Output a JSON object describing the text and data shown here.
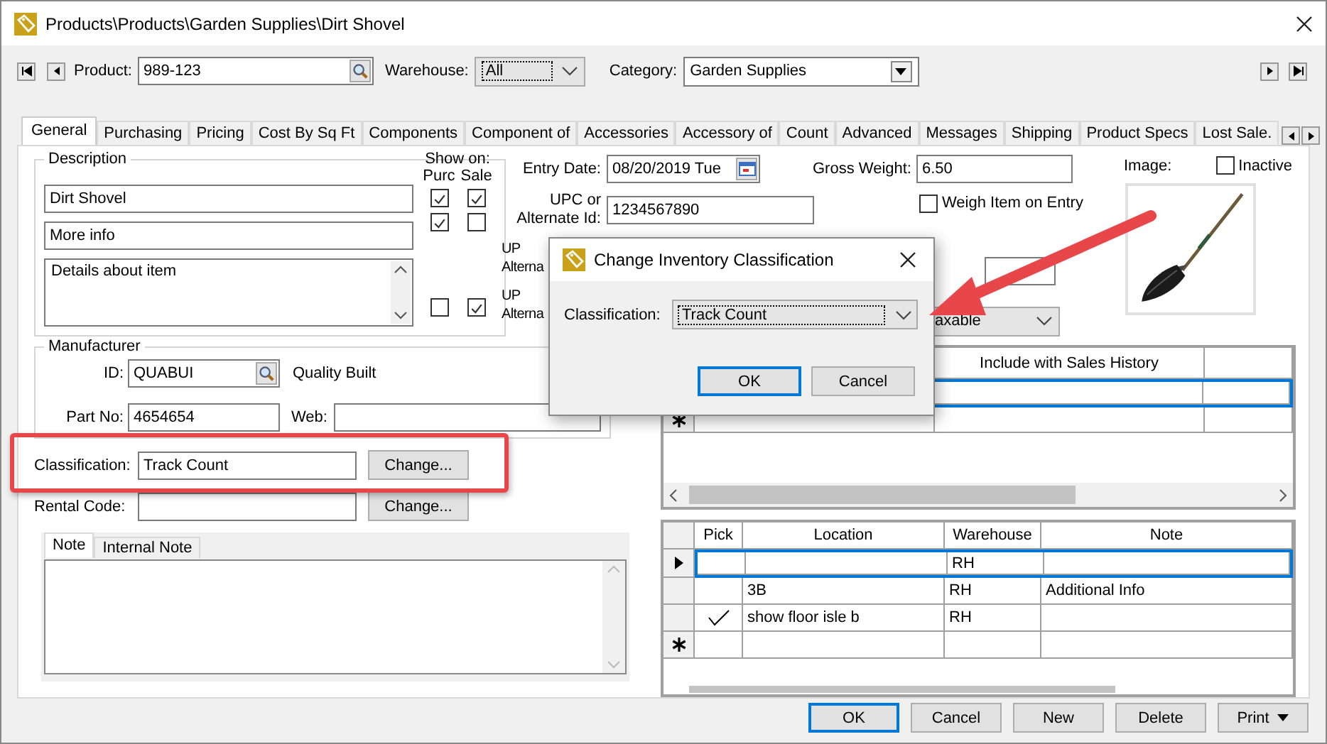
{
  "window": {
    "title": "Products\\Products\\Garden Supplies\\Dirt Shovel"
  },
  "toolbar": {
    "product": {
      "label": "Product:",
      "value": "989-123"
    },
    "warehouse": {
      "label": "Warehouse:",
      "value": "All"
    },
    "category": {
      "label": "Category:",
      "value": "Garden Supplies"
    }
  },
  "tabs": [
    {
      "label": "General",
      "selected": true
    },
    {
      "label": "Purchasing",
      "selected": false
    },
    {
      "label": "Pricing",
      "selected": false
    },
    {
      "label": "Cost By Sq Ft",
      "selected": false
    },
    {
      "label": "Components",
      "selected": false
    },
    {
      "label": "Component of",
      "selected": false
    },
    {
      "label": "Accessories",
      "selected": false
    },
    {
      "label": "Accessory of",
      "selected": false
    },
    {
      "label": "Count",
      "selected": false
    },
    {
      "label": "Advanced",
      "selected": false
    },
    {
      "label": "Messages",
      "selected": false
    },
    {
      "label": "Shipping",
      "selected": false
    },
    {
      "label": "Product Specs",
      "selected": false
    },
    {
      "label": "Lost Sale.",
      "selected": false
    }
  ],
  "description": {
    "title": "Description",
    "show_on": "Show on:",
    "columns": [
      "Purc",
      "Sale"
    ],
    "lines": [
      {
        "kind": "line",
        "value": "Dirt Shovel",
        "purc": true,
        "sale": true
      },
      {
        "kind": "line",
        "value": "More info",
        "purc": true,
        "sale": false
      },
      {
        "kind": "area",
        "value": "Details about item",
        "purc": false,
        "sale": true
      }
    ]
  },
  "details": {
    "entry_date": {
      "label": "Entry Date:",
      "value": "08/20/2019 Tue"
    },
    "upc": {
      "label_lines": [
        "UPC or",
        "Alternate Id:"
      ],
      "value": "1234567890"
    },
    "gross_weight": {
      "label": "Gross Weight:",
      "value": "6.50"
    },
    "weigh_item": {
      "label": "Weigh Item on Entry",
      "checked": false
    },
    "covered_labels": [
      {
        "lines": [
          "UP",
          "Alterna"
        ]
      },
      {
        "lines": [
          "UP",
          "Alterna"
        ]
      }
    ],
    "tax_select": {
      "value": "axable"
    }
  },
  "image": {
    "label": "Image:",
    "inactive": {
      "label": "Inactive",
      "checked": false
    }
  },
  "manufacturer": {
    "title": "Manufacturer",
    "id": {
      "label": "ID:",
      "value": "QUABUI"
    },
    "name": "Quality Built",
    "part_no": {
      "label": "Part No:",
      "value": "4654654"
    },
    "web": {
      "label": "Web:"
    }
  },
  "classification": {
    "label": "Classification:",
    "value": "Track Count",
    "button": "Change..."
  },
  "rental_code": {
    "label": "Rental Code:",
    "button": "Change..."
  },
  "note_tabs": [
    {
      "label": "Note",
      "selected": true
    },
    {
      "label": "Internal Note",
      "selected": false
    }
  ],
  "history_grid": {
    "columns": [
      "Include with Sales History"
    ],
    "rows": [
      {
        "selected": true
      }
    ]
  },
  "locations_grid": {
    "columns": [
      "Pick",
      "Location",
      "Warehouse",
      "Note"
    ],
    "rows": [
      {
        "pick": false,
        "warehouse": "RH",
        "selected": true
      },
      {
        "pick": false,
        "location": "3B",
        "warehouse": "RH",
        "note": "Additional Info",
        "selected": false
      },
      {
        "pick": true,
        "location": "show floor isle b",
        "warehouse": "RH",
        "selected": false
      }
    ]
  },
  "buttons": [
    {
      "label": "OK",
      "kind": "plain",
      "default": true
    },
    {
      "label": "Cancel",
      "kind": "plain",
      "default": false
    },
    {
      "label": "New",
      "kind": "plain",
      "default": false
    },
    {
      "label": "Delete",
      "kind": "plain",
      "default": false
    },
    {
      "label": "Print",
      "kind": "menu",
      "default": false
    }
  ],
  "dialog": {
    "title": "Change Inventory Classification",
    "label": "Classification:",
    "value": "Track Count",
    "buttons": [
      {
        "label": "OK",
        "default": true
      },
      {
        "label": "Cancel",
        "default": false
      }
    ]
  }
}
